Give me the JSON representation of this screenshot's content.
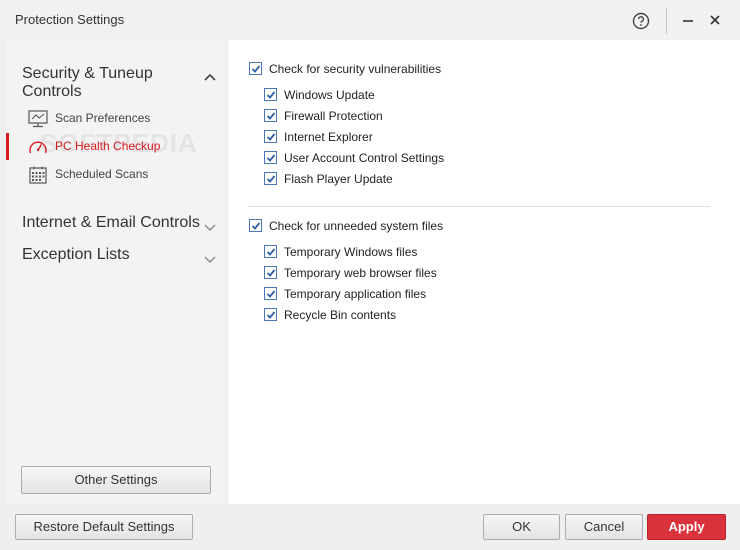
{
  "window": {
    "title": "Protection Settings"
  },
  "sidebar": {
    "section_security": "Security & Tuneup Controls",
    "items": [
      {
        "label": "Scan Preferences",
        "icon": "monitor-icon"
      },
      {
        "label": "PC Health Checkup",
        "icon": "gauge-icon",
        "active": true
      },
      {
        "label": "Scheduled Scans",
        "icon": "calendar-icon"
      }
    ],
    "section_internet": "Internet & Email Controls",
    "section_exceptions": "Exception Lists",
    "watermark": "SOFTPEDIA",
    "other_settings": "Other Settings"
  },
  "main": {
    "group1": {
      "label": "Check for security vulnerabilities",
      "items": [
        "Windows Update",
        "Firewall Protection",
        "Internet Explorer",
        "User Account Control Settings",
        "Flash Player Update"
      ]
    },
    "group2": {
      "label": "Check for unneeded system files",
      "items": [
        "Temporary Windows files",
        "Temporary web browser files",
        "Temporary application files",
        "Recycle Bin contents"
      ]
    }
  },
  "footer": {
    "restore": "Restore Default Settings",
    "ok": "OK",
    "cancel": "Cancel",
    "apply": "Apply"
  },
  "colors": {
    "accent_red": "#d71920",
    "apply_button": "#d9323a",
    "checkbox_blue": "#2e5fa8"
  }
}
